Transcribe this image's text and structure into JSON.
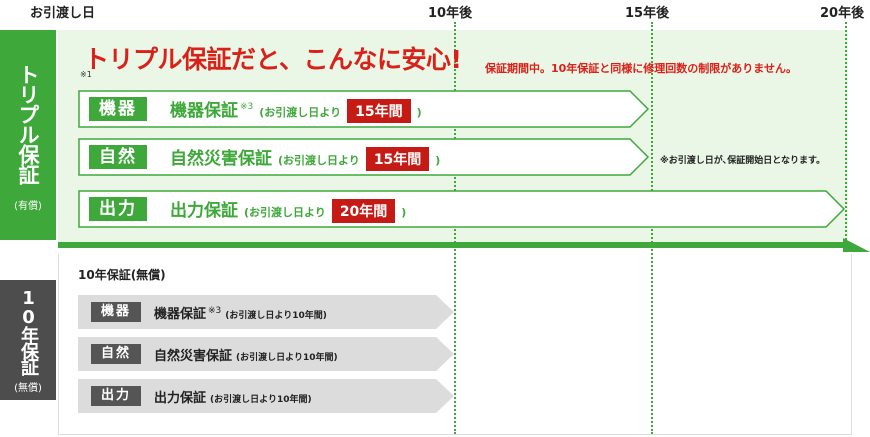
{
  "header": {
    "handover": "お引渡し日",
    "year10": "10年後",
    "year15": "15年後",
    "year20": "20年後"
  },
  "sidebar_triple": {
    "title": "トリプル保証",
    "sub": "(有償)"
  },
  "sidebar_ten": {
    "title": "10年保証",
    "sub": "(無償)"
  },
  "triple": {
    "title": "トリプル保証だと、こんなに安心!",
    "note": "※1",
    "subtitle": "保証期間中。10年保証と同様に修理回数の制限がありません。",
    "side_note": "※お引渡し日が､保証開始日となります。",
    "rows": [
      {
        "tag": "機器",
        "label": "機器保証",
        "sup": "※3",
        "paren_open": "(お引渡し日より",
        "years": "15年間",
        "paren_close": ")"
      },
      {
        "tag": "自然",
        "label": "自然災害保証",
        "sup": "",
        "paren_open": "(お引渡し日より",
        "years": "15年間",
        "paren_close": ")"
      },
      {
        "tag": "出力",
        "label": "出力保証",
        "sup": "",
        "paren_open": "(お引渡し日より",
        "years": "20年間",
        "paren_close": ")"
      }
    ]
  },
  "ten": {
    "title": "10年保証(無償)",
    "rows": [
      {
        "tag": "機器",
        "label": "機器保証",
        "sup": "※3",
        "paren": "(お引渡し日より10年間)"
      },
      {
        "tag": "自然",
        "label": "自然災害保証",
        "sup": "",
        "paren": "(お引渡し日より10年間)"
      },
      {
        "tag": "出力",
        "label": "出力保証",
        "sup": "",
        "paren": "(お引渡し日より10年間)"
      }
    ]
  },
  "colors": {
    "green": "#3ea83a",
    "red": "#c61b14",
    "gray": "#4d4d4d",
    "light_green": "#eaf6e6"
  }
}
